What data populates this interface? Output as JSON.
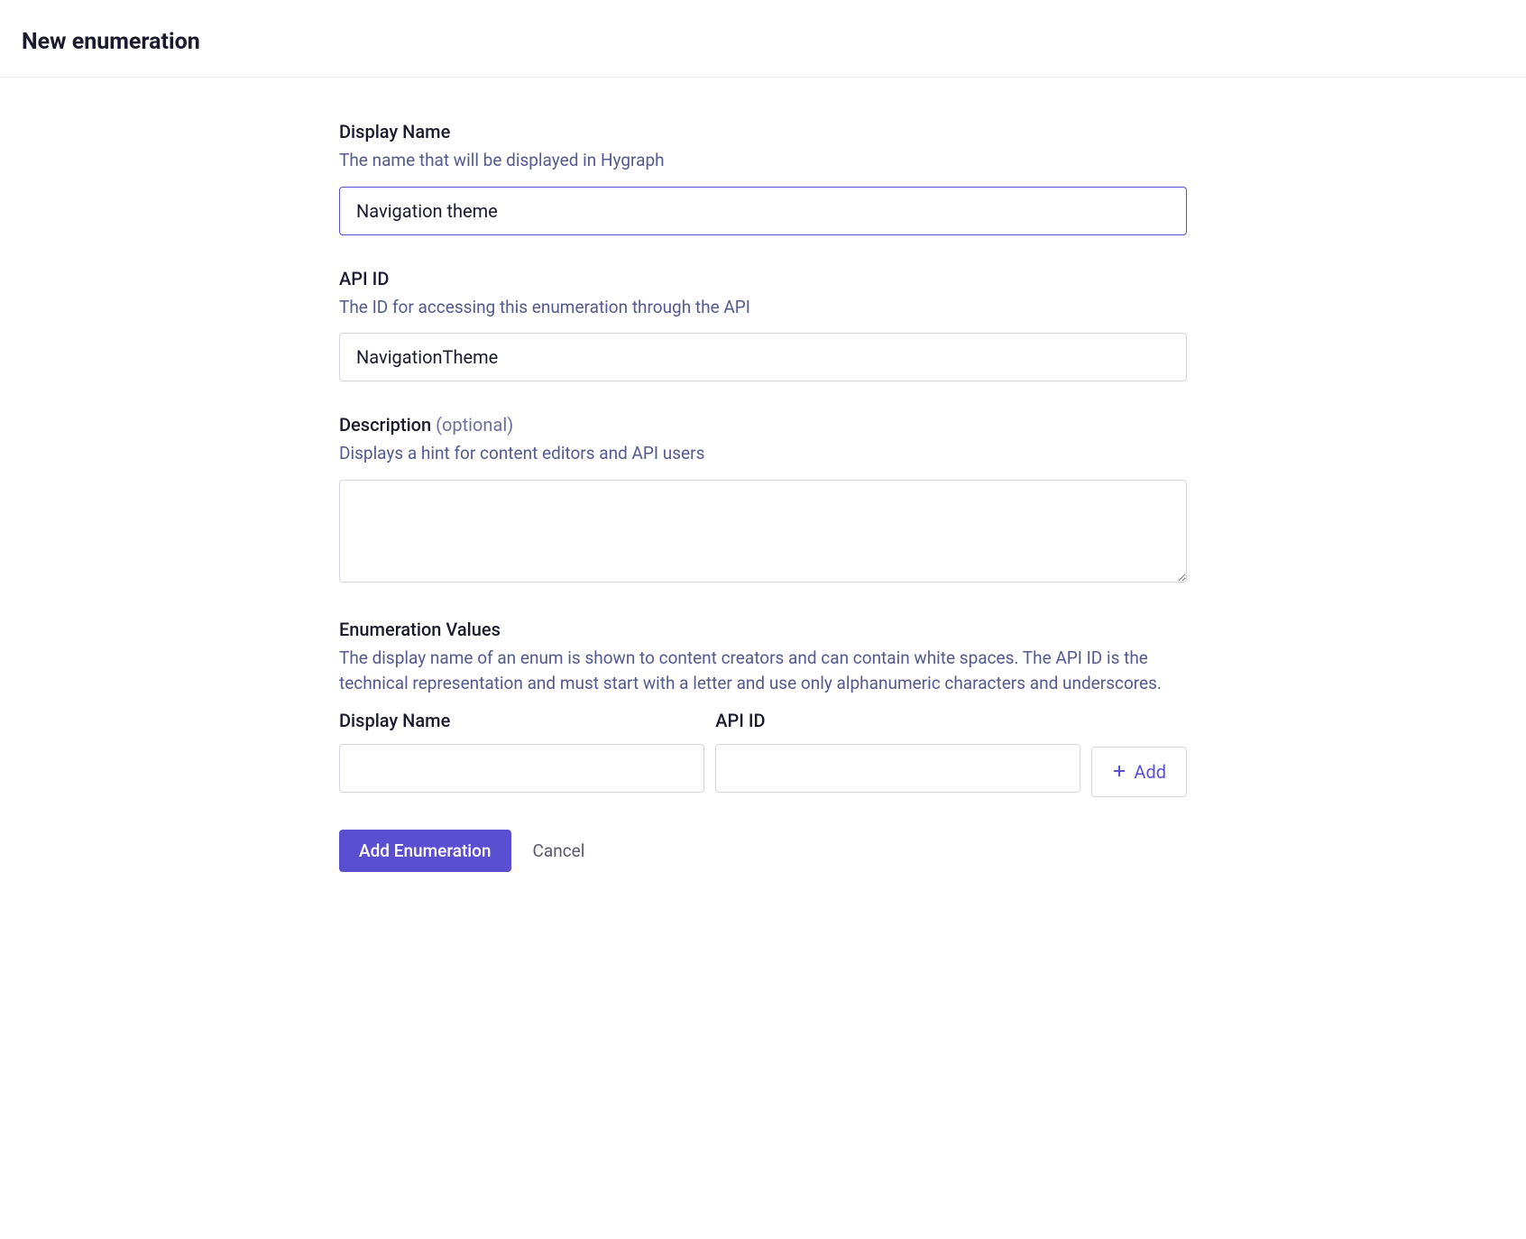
{
  "header": {
    "title": "New enumeration"
  },
  "fields": {
    "displayName": {
      "label": "Display Name",
      "hint": "The name that will be displayed in Hygraph",
      "value": "Navigation theme"
    },
    "apiId": {
      "label": "API ID",
      "hint": "The ID for accessing this enumeration through the API",
      "value": "NavigationTheme"
    },
    "description": {
      "label": "Description",
      "optional": "(optional)",
      "hint": "Displays a hint for content editors and API users",
      "value": ""
    },
    "enumValues": {
      "label": "Enumeration Values",
      "hint": "The display name of an enum is shown to content creators and can contain white spaces. The API ID is the technical representation and must start with a letter and use only alphanumeric characters and underscores.",
      "displayNameLabel": "Display Name",
      "apiIdLabel": "API ID",
      "addLabel": "Add"
    }
  },
  "actions": {
    "submit": "Add Enumeration",
    "cancel": "Cancel"
  }
}
